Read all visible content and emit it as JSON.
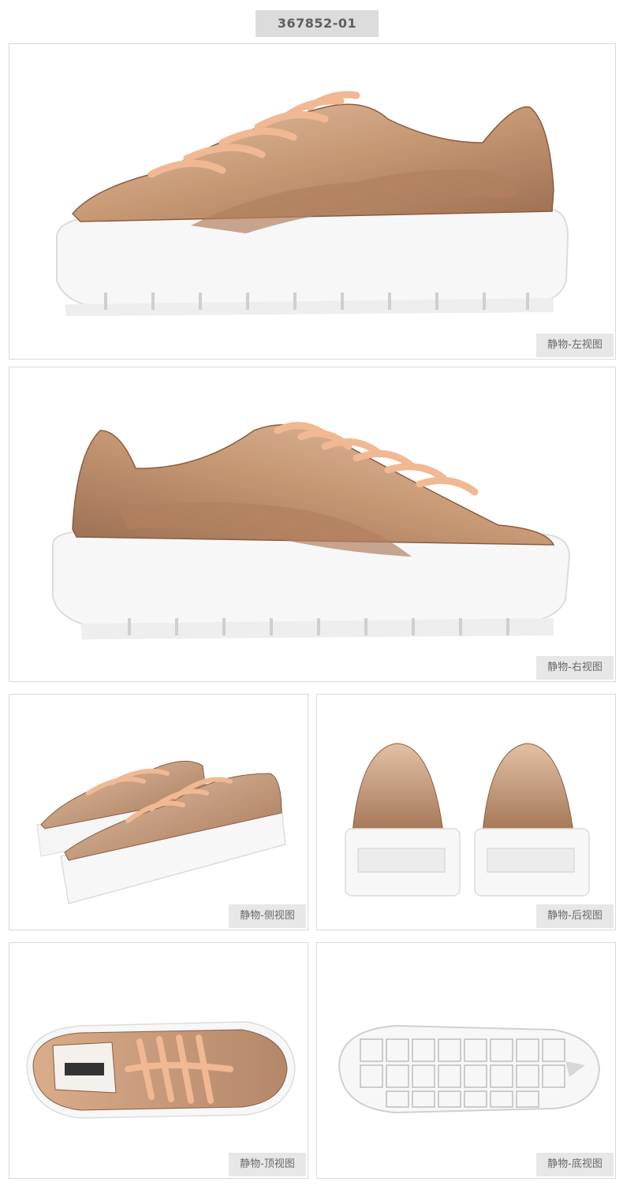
{
  "product": {
    "sku": "367852-01"
  },
  "views": {
    "left": {
      "caption": "静物-左视图"
    },
    "right": {
      "caption": "静物-右视图"
    },
    "side": {
      "caption": "静物-侧视图"
    },
    "back": {
      "caption": "静物-后视图"
    },
    "top": {
      "caption": "静物-顶视图"
    },
    "bottom": {
      "caption": "静物-底视图"
    }
  },
  "colors": {
    "upper": "#c99a77",
    "upper_shadow": "#9a6e50",
    "laces": "#f1b894",
    "sole": "#f7f7f7",
    "sole_edge": "#dcdcdc",
    "caption_bg": "#e7e7e7",
    "badge_bg": "#dcdcdc"
  }
}
